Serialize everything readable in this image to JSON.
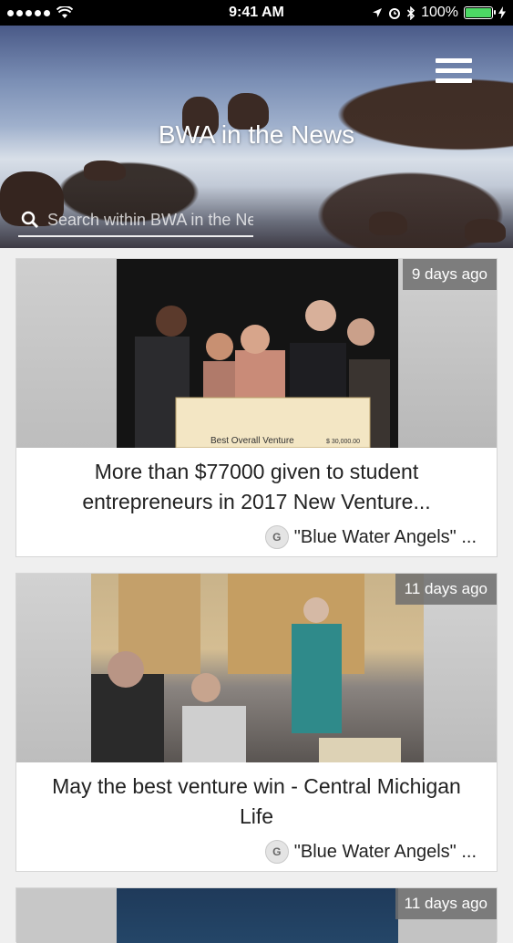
{
  "status_bar": {
    "time": "9:41 AM",
    "battery": "100%"
  },
  "header": {
    "title": "BWA in the News",
    "search_placeholder": "Search within BWA in the News"
  },
  "articles": [
    {
      "age": "9 days ago",
      "title": "More than $77000 given to student entrepreneurs in 2017 New Venture...",
      "source": "\"Blue Water Angels\" ...",
      "check_caption": "Best Overall Venture",
      "check_amount": "$ 30,000.00"
    },
    {
      "age": "11 days ago",
      "title": "May the best venture win - Central Michigan Life",
      "source": "\"Blue Water Angels\" ..."
    },
    {
      "age": "11 days ago"
    }
  ],
  "colors": {
    "battery_fill": "#4cd964",
    "badge_bg": "#6e6e6e"
  }
}
